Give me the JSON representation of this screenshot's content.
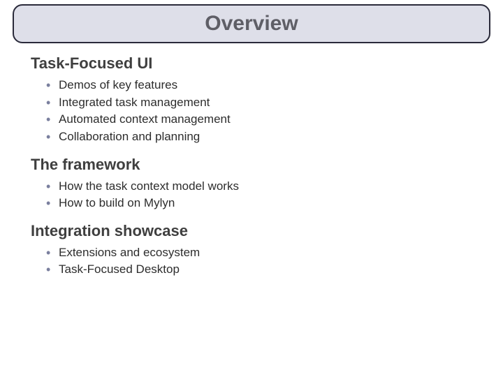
{
  "title": "Overview",
  "sections": [
    {
      "heading": "Task-Focused UI",
      "items": [
        "Demos of key features",
        "Integrated task management",
        "Automated context management",
        "Collaboration and planning"
      ]
    },
    {
      "heading": "The framework",
      "items": [
        "How the task context model works",
        "How to build on Mylyn"
      ]
    },
    {
      "heading": "Integration showcase",
      "items": [
        "Extensions and ecosystem",
        "Task-Focused Desktop"
      ]
    }
  ]
}
